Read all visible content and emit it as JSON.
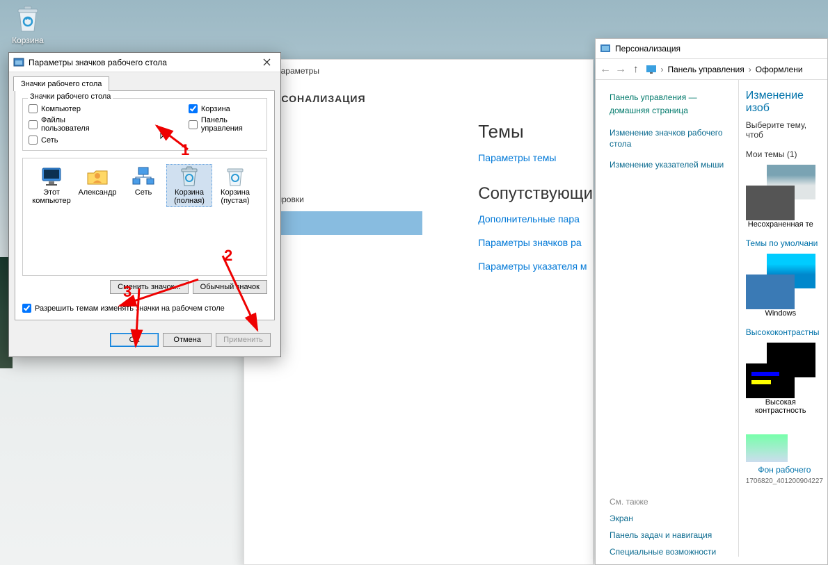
{
  "desktop": {
    "recycle_bin_label": "Корзина"
  },
  "settings": {
    "header": "Параметры",
    "section_title": "ПЕРСОНАЛИЗАЦИЯ",
    "nav_item_lock": "блокировки",
    "heading_themes": "Темы",
    "link_theme_params": "Параметры темы",
    "heading_related": "Сопутствующи",
    "link_sound": "Дополнительные пара",
    "link_icon_params": "Параметры значков ра",
    "link_pointer_params": "Параметры указателя м"
  },
  "dialog": {
    "title": "Параметры значков рабочего стола",
    "tab_label": "Значки рабочего стола",
    "fieldset_label": "Значки рабочего стола",
    "chk_computer": "Компьютер",
    "chk_recycle": "Корзина",
    "chk_userfiles": "Файлы пользователя",
    "chk_cpanel": "Панель управления",
    "chk_network": "Сеть",
    "icons": {
      "this_pc": "Этот компьютер",
      "user": "Александр",
      "network": "Сеть",
      "recycle_full": "Корзина (полная)",
      "recycle_empty": "Корзина (пустая)"
    },
    "btn_change": "Сменить значок...",
    "btn_default": "Обычный значок",
    "chk_allow_themes": "Разрешить темам изменять значки на рабочем столе",
    "btn_ok": "ОК",
    "btn_cancel": "Отмена",
    "btn_apply": "Применить"
  },
  "cp": {
    "title": "Персонализация",
    "crumb_cp": "Панель управления",
    "crumb_design": "Оформлени",
    "side_main": "Панель управления — домашняя страница",
    "side_link_icons": "Изменение значков рабочего стола",
    "side_link_pointers": "Изменение указателей мыши",
    "see_also": "См. также",
    "see_screen": "Экран",
    "see_taskbar": "Панель задач и навигация",
    "see_access": "Специальные возможности",
    "main_heading": "Изменение изоб",
    "main_sub": "Выберите тему, чтоб",
    "my_themes": "Мои темы (1)",
    "theme_unsaved": "Несохраненная те",
    "themes_default": "Темы по умолчани",
    "theme_windows": "Windows",
    "theme_hc_link": "Высококонтрастны",
    "theme_hc": "Высокая контрастность",
    "bottom_label": "Фон рабочего",
    "bottom_id": "1706820_401200904227"
  },
  "annot": {
    "l1": "1",
    "l2": "2",
    "l3": "3"
  }
}
